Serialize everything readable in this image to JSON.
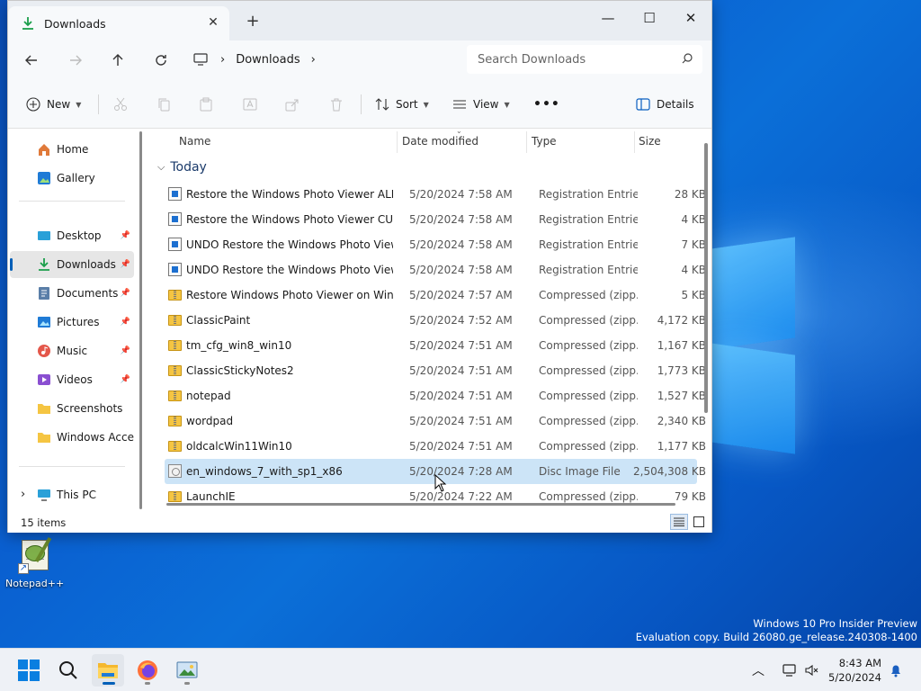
{
  "window": {
    "tab_title": "Downloads",
    "new_tab": "+",
    "controls": {
      "minimize": "—",
      "maximize": "☐",
      "close": "✕"
    }
  },
  "nav": {
    "breadcrumb": [
      "Downloads"
    ],
    "search_placeholder": "Search Downloads"
  },
  "commands": {
    "new": "New",
    "sort": "Sort",
    "view": "View",
    "more": "•••",
    "details": "Details"
  },
  "sidebar": {
    "items": [
      {
        "label": "Home",
        "icon": "home-icon"
      },
      {
        "label": "Gallery",
        "icon": "gallery-icon"
      },
      {
        "label": "Desktop",
        "icon": "desktop-icon",
        "pinned": true
      },
      {
        "label": "Downloads",
        "icon": "download-icon",
        "pinned": true,
        "selected": true
      },
      {
        "label": "Documents",
        "icon": "documents-icon",
        "pinned": true
      },
      {
        "label": "Pictures",
        "icon": "pictures-icon",
        "pinned": true
      },
      {
        "label": "Music",
        "icon": "music-icon",
        "pinned": true
      },
      {
        "label": "Videos",
        "icon": "videos-icon",
        "pinned": true
      },
      {
        "label": "Screenshots",
        "icon": "folder-icon"
      },
      {
        "label": "Windows Acces",
        "icon": "folder-icon"
      },
      {
        "label": "This PC",
        "icon": "pc-icon"
      }
    ]
  },
  "columns": {
    "name": "Name",
    "date": "Date modified",
    "type": "Type",
    "size": "Size"
  },
  "group_label": "Today",
  "files": [
    {
      "name": "Restore the Windows Photo Viewer ALL ...",
      "date": "5/20/2024 7:58 AM",
      "type": "Registration Entries",
      "size": "28 KB",
      "kind": "reg"
    },
    {
      "name": "Restore the Windows Photo Viewer CURR...",
      "date": "5/20/2024 7:58 AM",
      "type": "Registration Entries",
      "size": "4 KB",
      "kind": "reg"
    },
    {
      "name": "UNDO Restore the Windows Photo Viewe...",
      "date": "5/20/2024 7:58 AM",
      "type": "Registration Entries",
      "size": "7 KB",
      "kind": "reg"
    },
    {
      "name": "UNDO Restore the Windows Photo Viewe...",
      "date": "5/20/2024 7:58 AM",
      "type": "Registration Entries",
      "size": "4 KB",
      "kind": "reg"
    },
    {
      "name": "Restore Windows Photo Viewer on Wind...",
      "date": "5/20/2024 7:57 AM",
      "type": "Compressed (zipp...",
      "size": "5 KB",
      "kind": "zip"
    },
    {
      "name": "ClassicPaint",
      "date": "5/20/2024 7:52 AM",
      "type": "Compressed (zipp...",
      "size": "4,172 KB",
      "kind": "zip"
    },
    {
      "name": "tm_cfg_win8_win10",
      "date": "5/20/2024 7:51 AM",
      "type": "Compressed (zipp...",
      "size": "1,167 KB",
      "kind": "zip"
    },
    {
      "name": "ClassicStickyNotes2",
      "date": "5/20/2024 7:51 AM",
      "type": "Compressed (zipp...",
      "size": "1,773 KB",
      "kind": "zip"
    },
    {
      "name": "notepad",
      "date": "5/20/2024 7:51 AM",
      "type": "Compressed (zipp...",
      "size": "1,527 KB",
      "kind": "zip"
    },
    {
      "name": "wordpad",
      "date": "5/20/2024 7:51 AM",
      "type": "Compressed (zipp...",
      "size": "2,340 KB",
      "kind": "zip"
    },
    {
      "name": "oldcalcWin11Win10",
      "date": "5/20/2024 7:51 AM",
      "type": "Compressed (zipp...",
      "size": "1,177 KB",
      "kind": "zip"
    },
    {
      "name": "en_windows_7_with_sp1_x86",
      "date": "5/20/2024 7:28 AM",
      "type": "Disc Image File",
      "size": "2,504,308 KB",
      "kind": "iso",
      "selected": true
    },
    {
      "name": "LaunchIE",
      "date": "5/20/2024 7:22 AM",
      "type": "Compressed (zipp...",
      "size": "79 KB",
      "kind": "zip"
    }
  ],
  "status": {
    "item_count": "15 items"
  },
  "desktop": {
    "icon_label": "Notepad++",
    "watermark_line1": "Windows 10 Pro Insider Preview",
    "watermark_line2": "Evaluation copy. Build 26080.ge_release.240308-1400"
  },
  "taskbar": {
    "time": "8:43 AM",
    "date": "5/20/2024",
    "tray_overflow": "^"
  },
  "colors": {
    "accent": "#005fb8",
    "selection": "#cce4f7"
  }
}
